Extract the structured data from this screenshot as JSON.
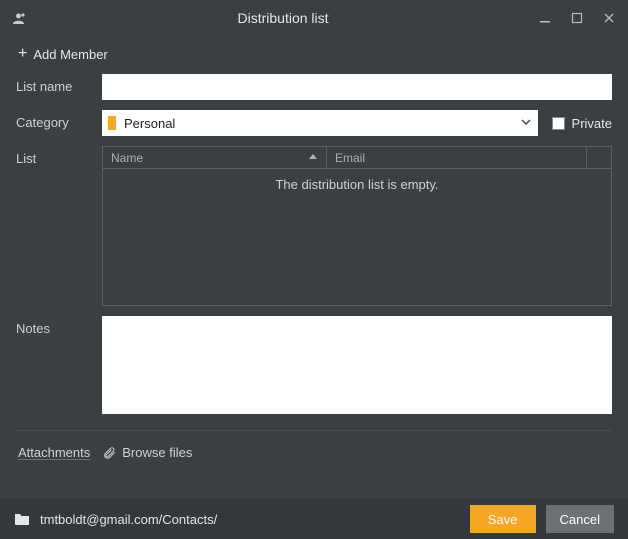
{
  "window": {
    "title": "Distribution list"
  },
  "toolbar": {
    "add_member_label": "Add Member"
  },
  "form": {
    "list_name": {
      "label": "List name",
      "value": ""
    },
    "category": {
      "label": "Category",
      "selected": "Personal",
      "swatch_color": "#f5a623"
    },
    "private": {
      "label": "Private",
      "checked": false
    },
    "list": {
      "label": "List",
      "columns": {
        "name": "Name",
        "email": "Email"
      },
      "sort": {
        "column": "name",
        "direction": "asc"
      },
      "rows": [],
      "empty_text": "The distribution list is empty."
    },
    "notes": {
      "label": "Notes",
      "value": ""
    }
  },
  "attachments": {
    "label": "Attachments",
    "browse_label": "Browse files"
  },
  "footer": {
    "path": "tmtboldt@gmail.com/Contacts/",
    "save_label": "Save",
    "cancel_label": "Cancel"
  },
  "colors": {
    "bg": "#3b3f44",
    "footer_bg": "#34373c",
    "accent": "#f5a623",
    "border": "#5a5e63"
  }
}
